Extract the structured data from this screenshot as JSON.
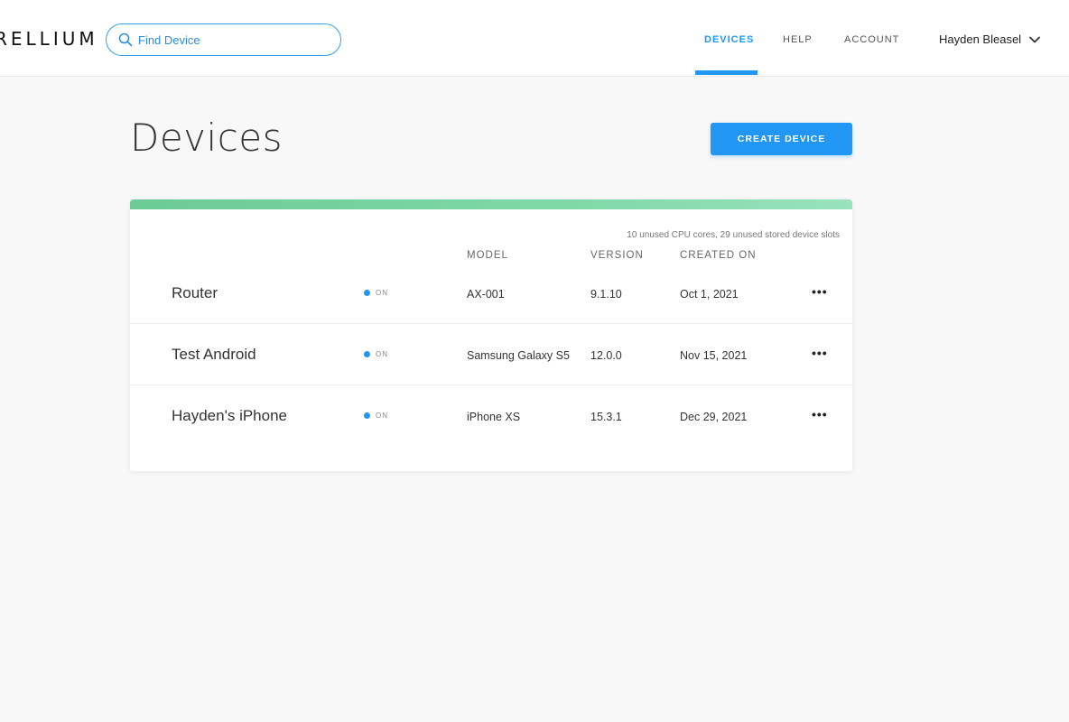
{
  "brand": {
    "logo_text": "RELLIUM"
  },
  "search": {
    "placeholder": "Find Device",
    "value": "",
    "icon": "search-icon"
  },
  "nav": {
    "items": [
      {
        "label": "DEVICES",
        "active": true
      },
      {
        "label": "HELP",
        "active": false
      },
      {
        "label": "ACCOUNT",
        "active": false
      }
    ],
    "user_name": "Hayden Bleasel",
    "user_menu_icon": "chevron-down-icon"
  },
  "page": {
    "title": "Devices",
    "create_button_label": "CREATE DEVICE"
  },
  "devices_table": {
    "usage_note": "10 unused CPU cores, 29 unused stored device slots",
    "columns": [
      "MODEL",
      "VERSION",
      "CREATED ON"
    ],
    "rows": [
      {
        "name": "Router",
        "status": "ON",
        "model": "AX-001",
        "version": "9.1.10",
        "created_on": "Oct 1, 2021",
        "actions_icon": "more-horizontal-icon"
      },
      {
        "name": "Test Android",
        "status": "ON",
        "model": "Samsung Galaxy S5",
        "version": "12.0.0",
        "created_on": "Nov 15, 2021",
        "actions_icon": "more-horizontal-icon"
      },
      {
        "name": "Hayden's iPhone",
        "status": "ON",
        "model": "iPhone XS",
        "version": "15.3.1",
        "created_on": "Dec 29, 2021",
        "actions_icon": "more-horizontal-icon"
      }
    ]
  },
  "colors": {
    "accent": "#2196f3",
    "status_on": "#2196f3",
    "card_bar_start": "#6bcb95",
    "card_bar_end": "#98e2bc",
    "background": "#f8f8f8"
  }
}
